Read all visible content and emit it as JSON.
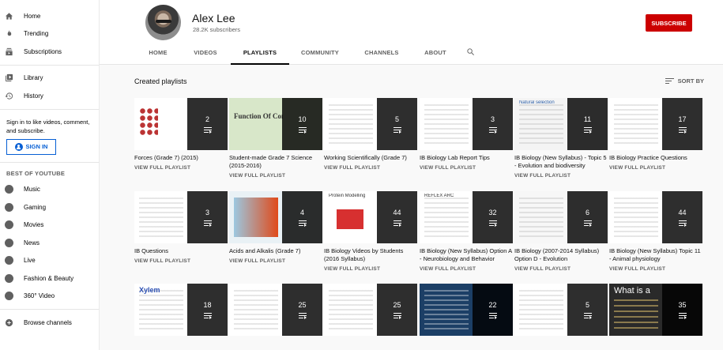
{
  "sidebar": {
    "main_items": [
      {
        "label": "Home",
        "icon": "home-icon"
      },
      {
        "label": "Trending",
        "icon": "trending-icon"
      },
      {
        "label": "Subscriptions",
        "icon": "subscriptions-icon"
      }
    ],
    "library_items": [
      {
        "label": "Library",
        "icon": "library-icon"
      },
      {
        "label": "History",
        "icon": "history-icon"
      }
    ],
    "signin_text": "Sign in to like videos, comment, and subscribe.",
    "signin_button": "SIGN IN",
    "best_heading": "BEST OF YOUTUBE",
    "best_items": [
      {
        "label": "Music",
        "icon": "music-icon"
      },
      {
        "label": "Gaming",
        "icon": "gaming-icon"
      },
      {
        "label": "Movies",
        "icon": "movies-icon"
      },
      {
        "label": "News",
        "icon": "news-icon"
      },
      {
        "label": "Live",
        "icon": "live-icon"
      },
      {
        "label": "Fashion & Beauty",
        "icon": "fashion-icon"
      },
      {
        "label": "360° Video",
        "icon": "360-video-icon"
      }
    ],
    "browse_channels": "Browse channels"
  },
  "channel": {
    "name": "Alex Lee",
    "subscribers": "28.2K subscribers",
    "subscribe_label": "SUBSCRIBE"
  },
  "tabs": [
    "HOME",
    "VIDEOS",
    "PLAYLISTS",
    "COMMUNITY",
    "CHANNELS",
    "ABOUT"
  ],
  "active_tab": "PLAYLISTS",
  "section": {
    "title": "Created playlists",
    "sort_label": "SORT BY"
  },
  "view_full_label": "VIEW FULL PLAYLIST",
  "playlists": [
    {
      "title": "Forces (Grade 7) (2015)",
      "count": "2"
    },
    {
      "title": "Student-made Grade 7 Science (2015-2016)",
      "count": "10"
    },
    {
      "title": "Working Scientifically (Grade 7)",
      "count": "5"
    },
    {
      "title": "IB Biology Lab Report Tips",
      "count": "3"
    },
    {
      "title": "IB Biology (New Syllabus) - Topic 5 - Evolution and biodiversity",
      "count": "11"
    },
    {
      "title": "IB Biology Practice Questions",
      "count": "17"
    },
    {
      "title": "IB Questions",
      "count": "3"
    },
    {
      "title": "Acids and Alkalis (Grade 7)",
      "count": "4"
    },
    {
      "title": "IB Biology Videos by Students (2016 Syllabus)",
      "count": "44"
    },
    {
      "title": "IB Biology (New Syllabus) Option A - Neurobiology and Behavior",
      "count": "32"
    },
    {
      "title": "IB Biology (2007-2014 Syllabus) Option D - Evolution",
      "count": "6"
    },
    {
      "title": "IB Biology (New Syllabus) Topic 11 - Animal physiology",
      "count": "44"
    },
    {
      "title": "",
      "count": "18"
    },
    {
      "title": "",
      "count": "25"
    },
    {
      "title": "",
      "count": "25"
    },
    {
      "title": "",
      "count": "22"
    },
    {
      "title": "",
      "count": "5"
    },
    {
      "title": "",
      "count": "35"
    }
  ],
  "thumb_texts": {
    "t2": "Function Of Components",
    "t5": "Natural selection",
    "t9": "Protein Modelling",
    "t10": "REFLEX ARC",
    "t13": "Xylem",
    "t18": "What is a"
  },
  "colors": {
    "accent_red": "#cc0000",
    "link_blue": "#065fd4"
  }
}
